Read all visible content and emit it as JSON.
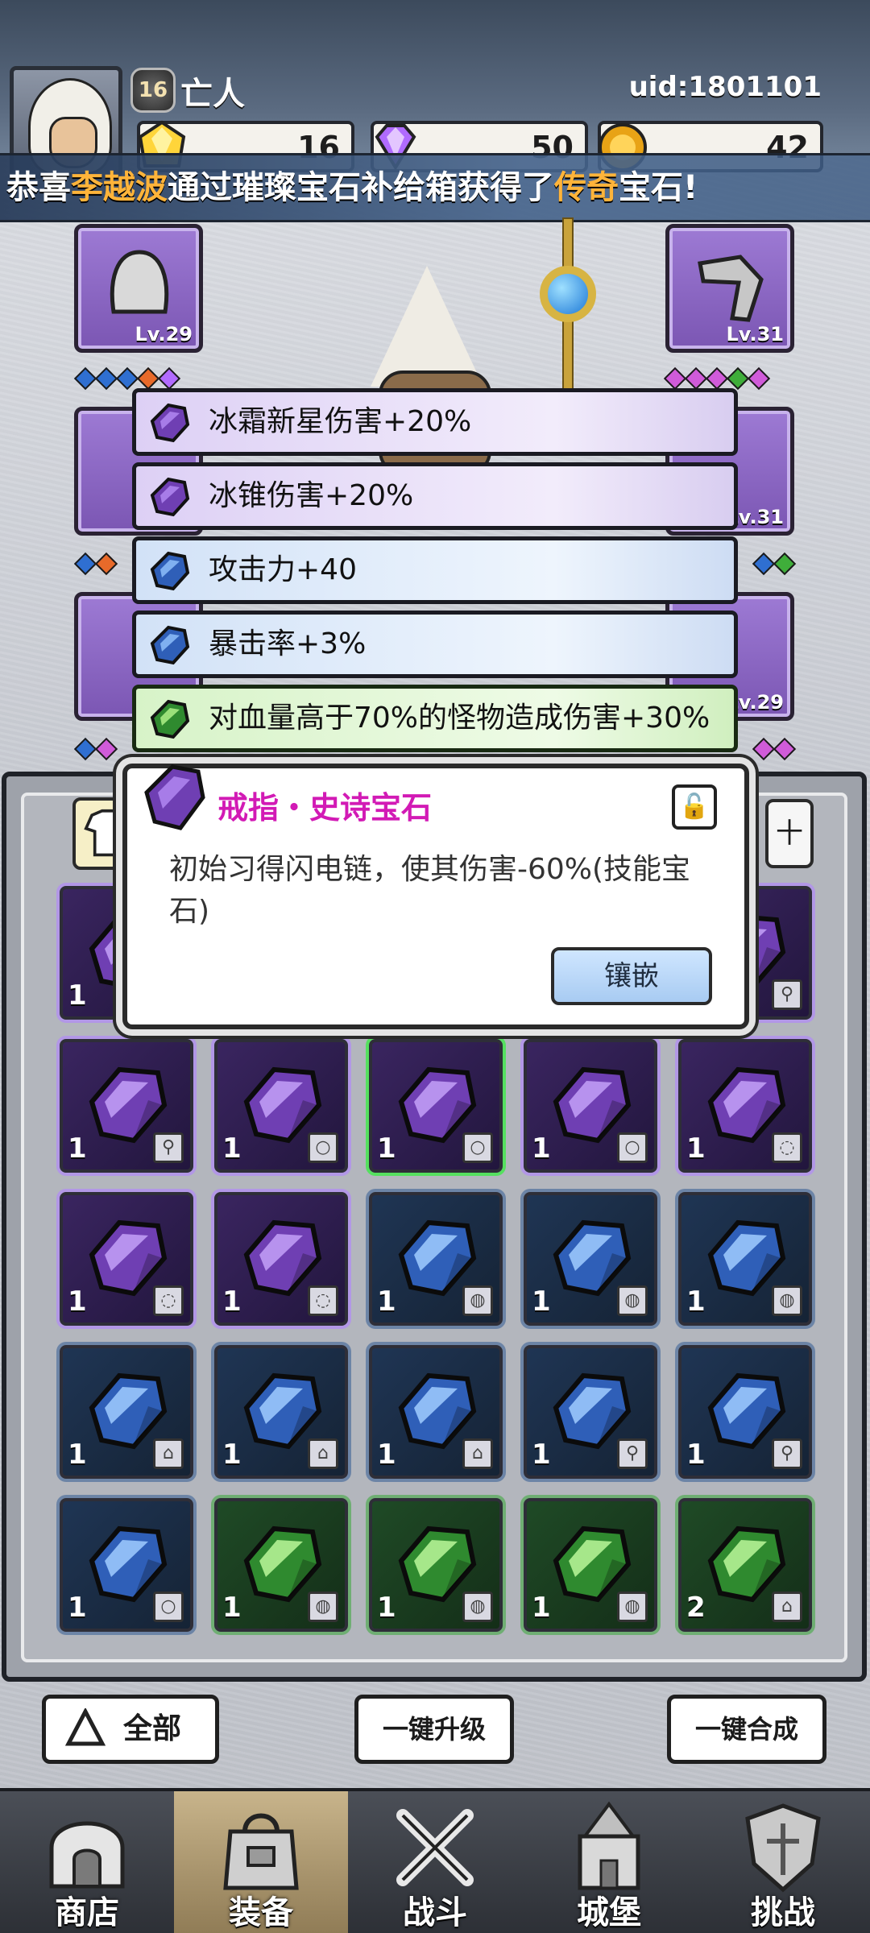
{
  "player": {
    "name": "亡人",
    "level": "16",
    "uid": "uid:1801101"
  },
  "currencies": {
    "gold": "16",
    "gem": "50",
    "coin": "42"
  },
  "broadcast": {
    "prefix": "恭喜",
    "player": "李越波",
    "middle": "通过璀璨宝石补给箱获得了",
    "rarity": "传奇",
    "suffix": "宝石!"
  },
  "equipment": {
    "slot_top_left_level": "Lv.29",
    "slot_top_right_level": "Lv.31",
    "slot_mid_right_level": "Lv.31",
    "slot_bottom_right_level": "Lv.29"
  },
  "attributes": [
    {
      "text": "冰霜新星伤害+20%",
      "color": "purple"
    },
    {
      "text": "冰锥伤害+20%",
      "color": "purple"
    },
    {
      "text": "攻击力+40",
      "color": "blue"
    },
    {
      "text": "暴击率+3%",
      "color": "blue"
    },
    {
      "text": "对血量高于70%的怪物造成伤害+30%",
      "color": "green"
    }
  ],
  "tooltip": {
    "title": "戒指・史诗宝石",
    "description": "初始习得闪电链，使其伤害-60%(技能宝石)",
    "inlay_label": "镶嵌"
  },
  "filter_right_label": "十",
  "inventory": [
    {
      "color": "purple",
      "count": "1"
    },
    {
      "color": "purple",
      "count": "1"
    },
    {
      "color": "purple",
      "count": "1"
    },
    {
      "color": "purple",
      "count": "1"
    },
    {
      "color": "purple",
      "count": "1"
    },
    {
      "color": "purple",
      "count": "1"
    },
    {
      "color": "purple",
      "count": "1"
    },
    {
      "color": "purple",
      "count": "1"
    },
    {
      "color": "purple",
      "count": "1"
    },
    {
      "color": "purple",
      "count": "1"
    },
    {
      "color": "purple",
      "count": "1"
    },
    {
      "color": "purple",
      "count": "1"
    },
    {
      "color": "blue",
      "count": "1"
    },
    {
      "color": "blue",
      "count": "1"
    },
    {
      "color": "blue",
      "count": "1"
    },
    {
      "color": "blue",
      "count": "1"
    },
    {
      "color": "blue",
      "count": "1"
    },
    {
      "color": "blue",
      "count": "1"
    },
    {
      "color": "blue",
      "count": "1"
    },
    {
      "color": "blue",
      "count": "1"
    },
    {
      "color": "blue",
      "count": "1"
    },
    {
      "color": "green",
      "count": "1"
    },
    {
      "color": "green",
      "count": "1"
    },
    {
      "color": "green",
      "count": "1"
    },
    {
      "color": "green",
      "count": "2"
    }
  ],
  "actions": {
    "all": "全部",
    "upgrade": "一键升级",
    "merge": "一键合成"
  },
  "nav": [
    {
      "label": "商店",
      "icon": "shop-icon"
    },
    {
      "label": "装备",
      "icon": "equipment-bag-icon"
    },
    {
      "label": "战斗",
      "icon": "crossed-swords-icon"
    },
    {
      "label": "城堡",
      "icon": "castle-icon"
    },
    {
      "label": "挑战",
      "icon": "challenge-shield-icon"
    }
  ],
  "colors": {
    "purple": "#7b56b3",
    "blue": "#2f6fd1",
    "green": "#3fae3a",
    "epic_title": "#d21ab5",
    "broadcast_highlight": "#ffb43a"
  }
}
